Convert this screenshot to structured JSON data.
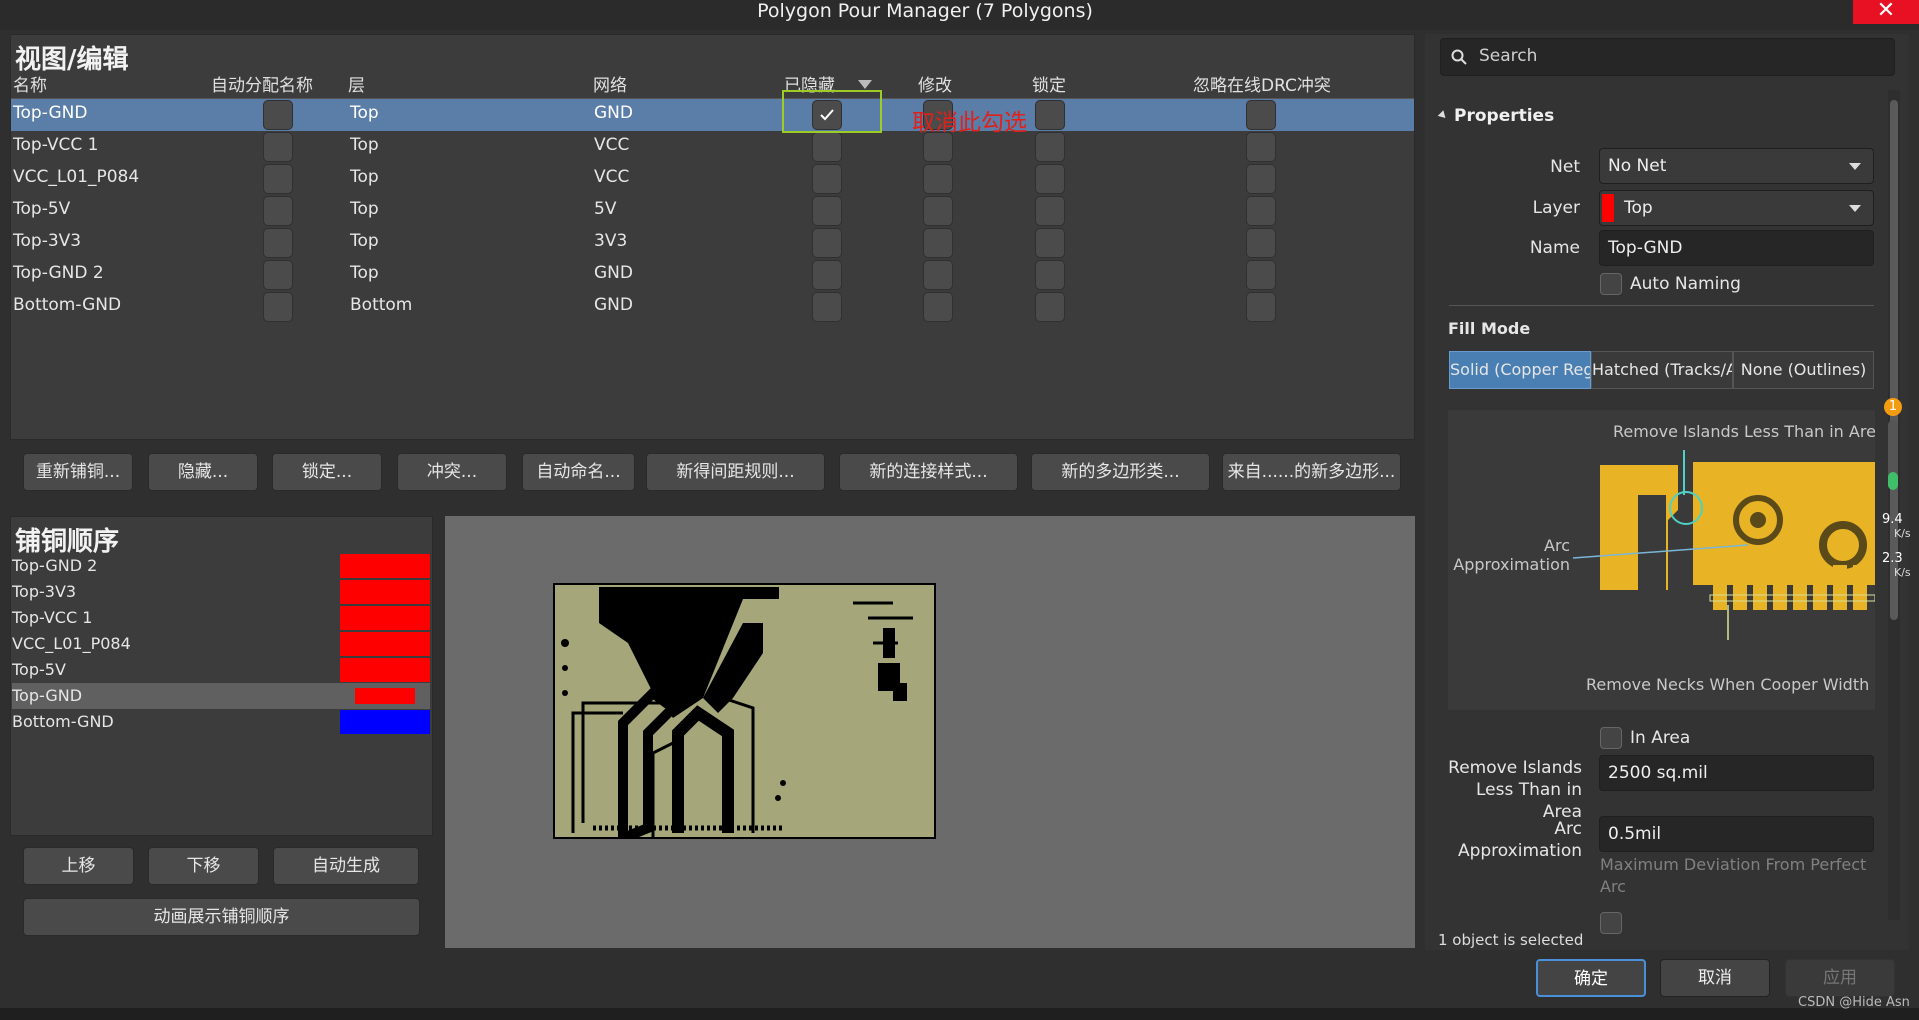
{
  "window": {
    "title": "Polygon Pour Manager (7 Polygons)",
    "close": "✕"
  },
  "view_edit": {
    "title": "视图/编辑",
    "columns": [
      "名称",
      "自动分配名称",
      "层",
      "网络",
      "已隐藏",
      "修改",
      "锁定",
      "忽略在线DRC冲突"
    ],
    "rows": [
      {
        "name": "Top-GND",
        "layer": "Top",
        "net": "GND"
      },
      {
        "name": "Top-VCC 1",
        "layer": "Top",
        "net": "VCC"
      },
      {
        "name": "VCC_L01_P084",
        "layer": "Top",
        "net": "VCC"
      },
      {
        "name": "Top-5V",
        "layer": "Top",
        "net": "5V"
      },
      {
        "name": "Top-3V3",
        "layer": "Top",
        "net": "3V3"
      },
      {
        "name": "Top-GND 2",
        "layer": "Top",
        "net": "GND"
      },
      {
        "name": "Bottom-GND",
        "layer": "Bottom",
        "net": "GND"
      }
    ],
    "annotation": "取消此勾选",
    "buttons": [
      "重新铺铜...",
      "隐藏...",
      "锁定...",
      "冲突...",
      "自动命名...",
      "新得间距规则...",
      "新的连接样式...",
      "新的多边形类...",
      "来自......的新多边形..."
    ]
  },
  "pour_order": {
    "title": "铺铜顺序",
    "items": [
      {
        "name": "Top-GND 2",
        "color": "#ff0000"
      },
      {
        "name": "Top-3V3",
        "color": "#ff0000"
      },
      {
        "name": "Top-VCC 1",
        "color": "#ff0000"
      },
      {
        "name": "VCC_L01_P084",
        "color": "#ff0000"
      },
      {
        "name": "Top-5V",
        "color": "#ff0000"
      },
      {
        "name": "Top-GND",
        "color": "#ff0000"
      },
      {
        "name": "Bottom-GND",
        "color": "#0000ff"
      }
    ],
    "buttons": [
      "上移",
      "下移",
      "自动生成"
    ],
    "animate": "动画展示铺铜顺序"
  },
  "properties": {
    "search_placeholder": "Search",
    "section": "Properties",
    "net_label": "Net",
    "net_value": "No Net",
    "layer_label": "Layer",
    "layer_value": "Top",
    "name_label": "Name",
    "name_value": "Top-GND",
    "auto_naming": "Auto Naming",
    "fill_mode": "Fill Mode",
    "fill_options": [
      "Solid (Copper Reg",
      "Hatched (Tracks/A",
      "None (Outlines)"
    ],
    "diagram": {
      "remove_islands": "Remove Islands Less Than in Area",
      "arc": "Arc Approximation",
      "necks": "Remove Necks When Cooper Width"
    },
    "in_area": "In Area",
    "remove_islands_label": "Remove Islands Less Than in Area",
    "remove_islands_value": "2500 sq.mil",
    "arc_label": "Arc Approximation",
    "arc_value": "0.5mil",
    "arc_hint": "Maximum Deviation From Perfect Arc",
    "selected": "1 object is selected"
  },
  "net_meter": {
    "badge": "1",
    "up": "9.4",
    "up_unit": "K/s",
    "down": "2.3",
    "down_unit": "K/s"
  },
  "footer": {
    "ok": "确定",
    "cancel": "取消",
    "apply": "应用",
    "watermark": "CSDN @Hide Asn"
  }
}
